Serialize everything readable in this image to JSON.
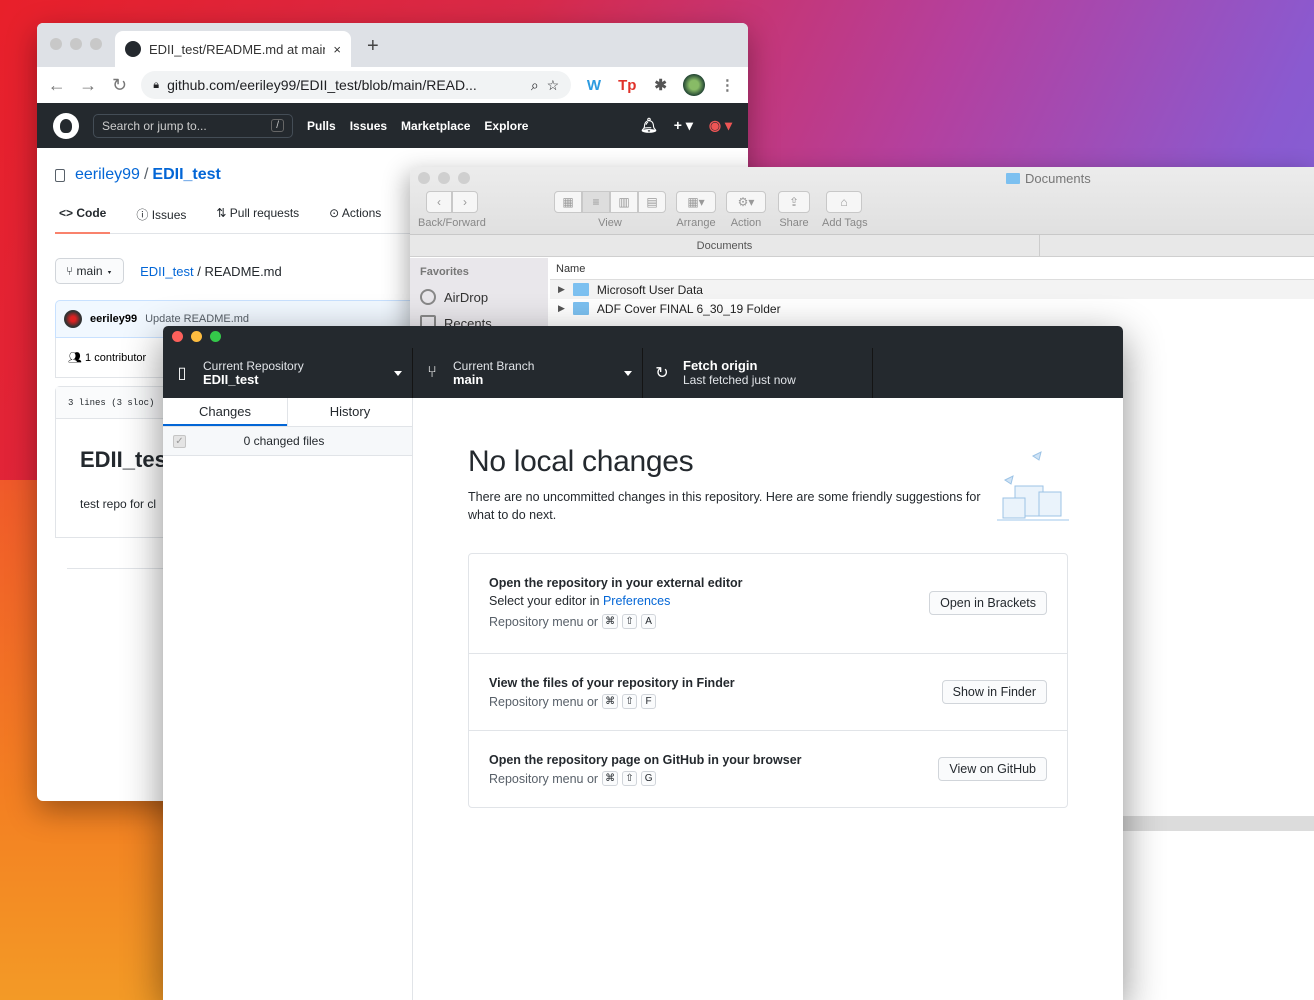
{
  "chrome": {
    "tab_title": "EDII_test/README.md at main",
    "url": "github.com/eeriley99/EDII_test/blob/main/READ...",
    "new_tab_label": "+",
    "close_label": "×"
  },
  "github": {
    "search_placeholder": "Search or jump to...",
    "search_key": "/",
    "nav": [
      "Pulls",
      "Issues",
      "Marketplace",
      "Explore"
    ],
    "owner": "eeriley99",
    "separator": "/",
    "repo": "EDII_test",
    "tabs": [
      "Code",
      "Issues",
      "Pull requests",
      "Actions"
    ],
    "branch": "main",
    "path_repo": "EDII_test",
    "path_file": "README.md",
    "commit_author": "eeriley99",
    "commit_message": "Update README.md",
    "contributors": "1 contributor",
    "file_meta": "3 lines (3 sloc)",
    "readme_title": "EDII_tes",
    "readme_text": "test repo for cl"
  },
  "finder": {
    "title": "Documents",
    "toolbar": {
      "back_forward": "Back/Forward",
      "view": "View",
      "arrange": "Arrange",
      "action": "Action",
      "share": "Share",
      "add_tags": "Add Tags"
    },
    "path_label": "Documents",
    "sidebar_heading": "Favorites",
    "sidebar_items": [
      "AirDrop",
      "Recents"
    ],
    "column_name": "Name",
    "rows": [
      "Microsoft User Data",
      "ADF Cover FINAL 6_30_19 Folder"
    ]
  },
  "desktop": {
    "repo_label": "Current Repository",
    "repo_value": "EDII_test",
    "branch_label": "Current Branch",
    "branch_value": "main",
    "fetch_title": "Fetch origin",
    "fetch_sub": "Last fetched just now",
    "tab_changes": "Changes",
    "tab_history": "History",
    "changed_files": "0 changed files",
    "heading": "No local changes",
    "description": "There are no uncommitted changes in this repository. Here are some friendly suggestions for what to do next.",
    "suggestions": [
      {
        "title": "Open the repository in your external editor",
        "sub_prefix": "Select your editor in ",
        "sub_link": "Preferences",
        "keys_prefix": "Repository menu or",
        "keys": [
          "⌘",
          "⇧",
          "A"
        ],
        "button": "Open in Brackets"
      },
      {
        "title": "View the files of your repository in Finder",
        "keys_prefix": "Repository menu or",
        "keys": [
          "⌘",
          "⇧",
          "F"
        ],
        "button": "Show in Finder"
      },
      {
        "title": "Open the repository page on GitHub in your browser",
        "keys_prefix": "Repository menu or",
        "keys": [
          "⌘",
          "⇧",
          "G"
        ],
        "button": "View on GitHub"
      }
    ]
  },
  "colors": {
    "gh_dark": "#24292e",
    "link_blue": "#0366d6",
    "tab_accent": "#f9826c",
    "traffic_red": "#fc605b",
    "traffic_yellow": "#fdbc40",
    "traffic_green": "#34c84a"
  }
}
